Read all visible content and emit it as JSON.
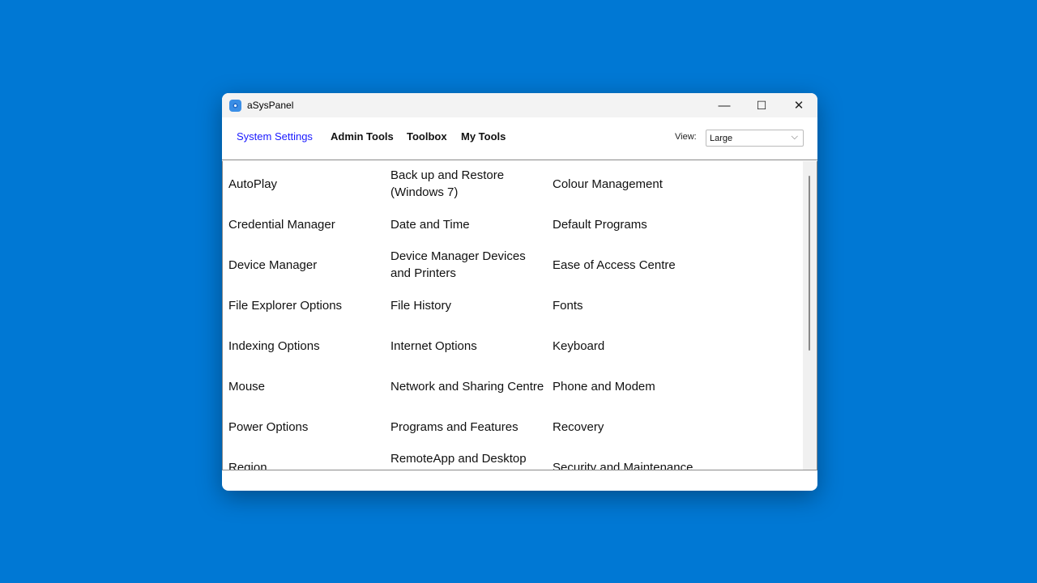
{
  "window": {
    "title": "aSysPanel",
    "minimize": "—",
    "maximize": "☐",
    "close": "✕"
  },
  "tabs": [
    {
      "label": "System Settings",
      "active": true
    },
    {
      "label": "Admin Tools"
    },
    {
      "label": "Toolbox"
    },
    {
      "label": "My Tools"
    }
  ],
  "view": {
    "label": "View:",
    "value": "Large"
  },
  "items": [
    [
      "AutoPlay",
      "Back up and Restore (Windows 7)",
      "Colour Management"
    ],
    [
      "Credential Manager",
      "Date and Time",
      "Default Programs"
    ],
    [
      "Device Manager",
      "Device Manager Devices and Printers",
      "Ease of Access Centre"
    ],
    [
      "File Explorer Options",
      "File History",
      "Fonts"
    ],
    [
      "Indexing Options",
      "Internet Options",
      "Keyboard"
    ],
    [
      "Mouse",
      "Network and Sharing Centre",
      "Phone and Modem"
    ],
    [
      "Power Options",
      "Programs and Features",
      "Recovery"
    ],
    [
      "Region",
      "RemoteApp and Desktop Connections",
      "Security and Maintenance"
    ]
  ],
  "colors": {
    "desktop": "#0078d4",
    "active_tab": "#1a1aff"
  }
}
